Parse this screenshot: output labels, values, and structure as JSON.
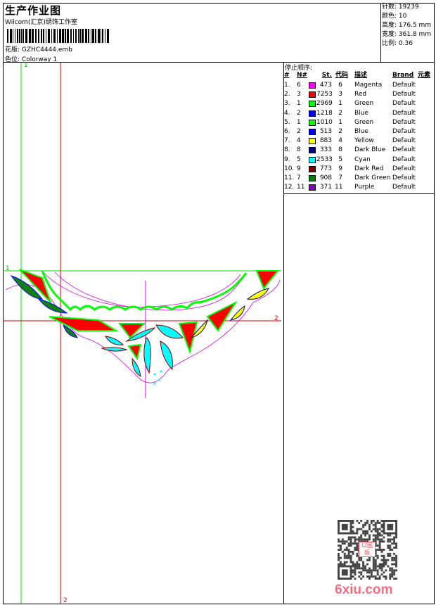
{
  "header": {
    "title": "生产作业图",
    "company": "Wilcom(汇京)绣饰工作室",
    "file_label": "花版:",
    "file_value": "GZHC4444.emb",
    "colorway_label": "色位:",
    "colorway_value": "Colorway 1"
  },
  "info": [
    {
      "label": "针数:",
      "value": "19239"
    },
    {
      "label": "颜色:",
      "value": "10"
    },
    {
      "label": "高度:",
      "value": "176.5 mm"
    },
    {
      "label": "宽度:",
      "value": "361.8 mm"
    },
    {
      "label": "比例:",
      "value": "0.36"
    }
  ],
  "stop_sequence": {
    "title": "停止顺序:",
    "headers": {
      "idx": "#",
      "n": "N#",
      "st": "St.",
      "code": "代码",
      "desc": "描述",
      "brand": "Brand",
      "element": "元素"
    },
    "rows": [
      {
        "idx": "1.",
        "n": "6",
        "color": "#ff00ff",
        "st": "473",
        "code": "6",
        "desc": "Magenta",
        "brand": "Default"
      },
      {
        "idx": "2.",
        "n": "3",
        "color": "#ff0000",
        "st": "7253",
        "code": "3",
        "desc": "Red",
        "brand": "Default"
      },
      {
        "idx": "3.",
        "n": "1",
        "color": "#00ff00",
        "st": "2969",
        "code": "1",
        "desc": "Green",
        "brand": "Default"
      },
      {
        "idx": "4.",
        "n": "2",
        "color": "#0000ff",
        "st": "1218",
        "code": "2",
        "desc": "Blue",
        "brand": "Default"
      },
      {
        "idx": "5.",
        "n": "1",
        "color": "#00ff00",
        "st": "1010",
        "code": "1",
        "desc": "Green",
        "brand": "Default"
      },
      {
        "idx": "6.",
        "n": "2",
        "color": "#0000ff",
        "st": "513",
        "code": "2",
        "desc": "Blue",
        "brand": "Default"
      },
      {
        "idx": "7.",
        "n": "4",
        "color": "#ffff00",
        "st": "883",
        "code": "4",
        "desc": "Yellow",
        "brand": "Default"
      },
      {
        "idx": "8.",
        "n": "8",
        "color": "#000080",
        "st": "333",
        "code": "8",
        "desc": "Dark Blue",
        "brand": "Default"
      },
      {
        "idx": "9.",
        "n": "5",
        "color": "#00ffff",
        "st": "2533",
        "code": "5",
        "desc": "Cyan",
        "brand": "Default"
      },
      {
        "idx": "10.",
        "n": "9",
        "color": "#800000",
        "st": "773",
        "code": "9",
        "desc": "Dark Red",
        "brand": "Default"
      },
      {
        "idx": "11.",
        "n": "7",
        "color": "#008000",
        "st": "908",
        "code": "7",
        "desc": "Dark Green",
        "brand": "Default"
      },
      {
        "idx": "12.",
        "n": "11",
        "color": "#8000c0",
        "st": "371",
        "code": "11",
        "desc": "Purple",
        "brand": "Default"
      }
    ]
  },
  "markers": {
    "green": "1",
    "red": "2"
  },
  "watermark": {
    "logo": "6xiu.com",
    "seal": "以图版"
  }
}
